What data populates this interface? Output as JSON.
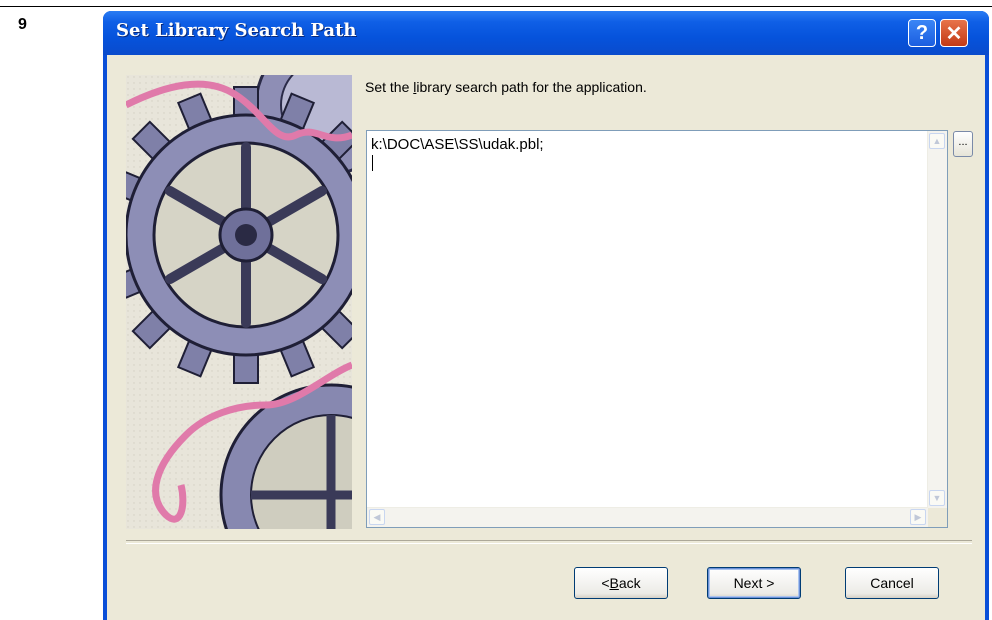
{
  "step_number": "9",
  "dialog": {
    "title": "Set Library Search Path",
    "help_label": "?",
    "close_label": "✕",
    "instruction_before": "Set the ",
    "instruction_underline": "l",
    "instruction_after": "ibrary search path for the application.",
    "path_value": "k:\\DOC\\ASE\\SS\\udak.pbl;",
    "browse_label": "...",
    "buttons": {
      "back_prefix": "< ",
      "back_underline": "B",
      "back_rest": "ack",
      "next": "Next >",
      "cancel": "Cancel"
    }
  },
  "icons": {
    "scroll_up": "scroll-up-arrow-icon",
    "scroll_down": "scroll-down-arrow-icon",
    "scroll_left": "scroll-left-arrow-icon",
    "scroll_right": "scroll-right-arrow-icon"
  },
  "colors": {
    "titlebar": "#0a4fd8",
    "client_background": "#ece9d8",
    "close_button": "#c23a16"
  }
}
